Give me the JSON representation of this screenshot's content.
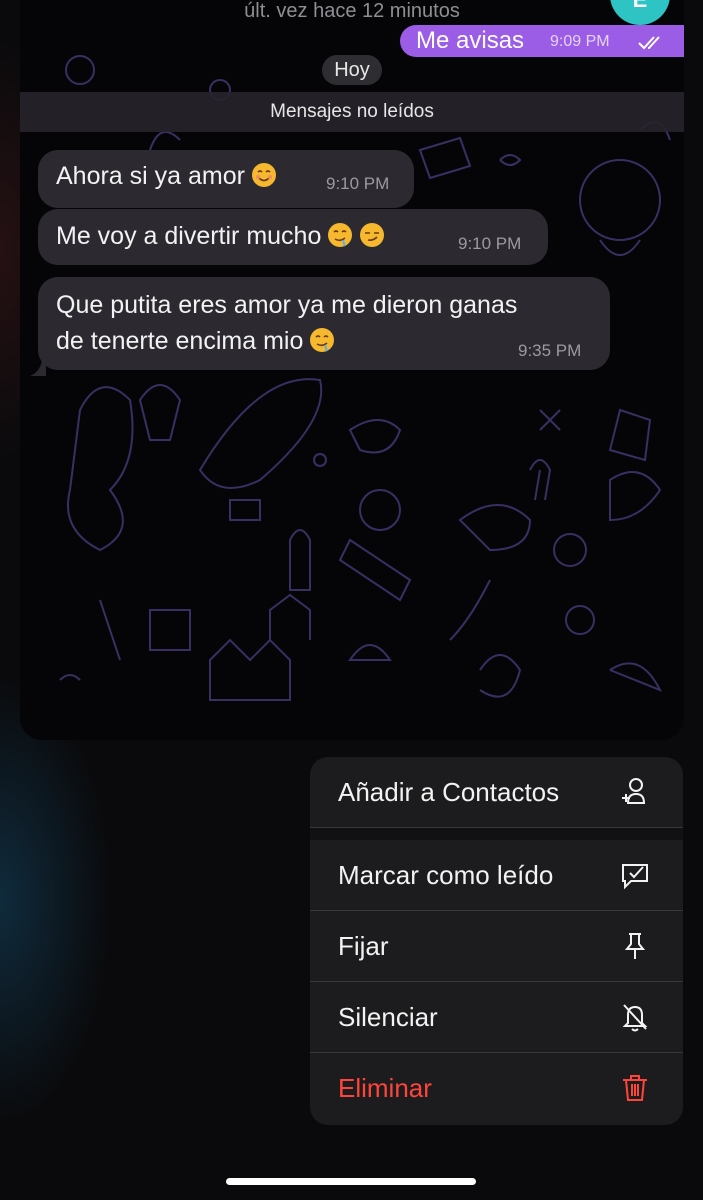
{
  "header": {
    "status": "últ. vez hace 12 minutos",
    "avatar_initial": "E"
  },
  "messages": {
    "outgoing": [
      {
        "text": "Me avisas",
        "time": "9:09 PM",
        "read": true
      }
    ],
    "date_divider": "Hoy",
    "unread_divider": "Mensajes no leídos",
    "incoming": [
      {
        "text": "Ahora si ya amor",
        "emoji": [
          "smiling-face-icon"
        ],
        "time": "9:10 PM"
      },
      {
        "text": "Me voy a divertir mucho",
        "emoji": [
          "drooling-face-icon",
          "smirking-face-icon"
        ],
        "time": "9:10 PM"
      },
      {
        "text_line1": "Que putita eres amor ya me dieron ganas",
        "text_line2": "de tenerte encima mio",
        "emoji": [
          "drooling-face-icon"
        ],
        "time": "9:35 PM"
      }
    ]
  },
  "context_menu": {
    "items": [
      {
        "label": "Añadir a Contactos",
        "icon": "add-contact-icon"
      },
      {
        "label": "Marcar como leído",
        "icon": "mark-read-icon"
      },
      {
        "label": "Fijar",
        "icon": "pin-icon"
      },
      {
        "label": "Silenciar",
        "icon": "mute-bell-icon"
      },
      {
        "label": "Eliminar",
        "icon": "trash-icon",
        "destructive": true
      }
    ]
  },
  "colors": {
    "outgoing_bubble": "#9b5de5",
    "incoming_bubble": "#2c2a30",
    "destructive": "#ff453a",
    "avatar": "#2ec4c4",
    "menu_background": "#1c1c1e"
  }
}
